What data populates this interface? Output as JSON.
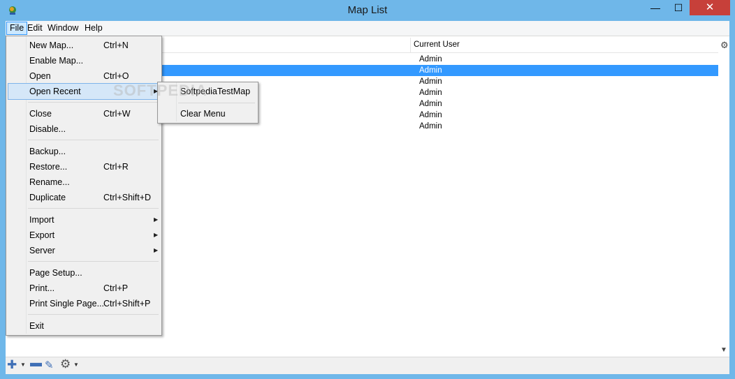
{
  "window": {
    "title": "Map List",
    "minimize_glyph": "—",
    "maximize_glyph": "☐",
    "close_glyph": "✕"
  },
  "menubar": {
    "file": "File",
    "edit": "Edit",
    "window": "Window",
    "help": "Help"
  },
  "table": {
    "column_header": "Current User",
    "rows": [
      "Admin",
      "Admin",
      "Admin",
      "Admin",
      "Admin",
      "Admin",
      "Admin"
    ],
    "selected_row": 1
  },
  "file_menu": {
    "items": [
      {
        "label": "New Map...",
        "shortcut": "Ctrl+N"
      },
      {
        "label": "Enable Map...",
        "shortcut": ""
      },
      {
        "label": "Open",
        "shortcut": "Ctrl+O"
      },
      {
        "label": "Open Recent",
        "shortcut": ""
      },
      {
        "label": "Close",
        "shortcut": "Ctrl+W"
      },
      {
        "label": "Disable...",
        "shortcut": ""
      },
      {
        "label": "Backup...",
        "shortcut": ""
      },
      {
        "label": "Restore...",
        "shortcut": "Ctrl+R"
      },
      {
        "label": "Rename...",
        "shortcut": ""
      },
      {
        "label": "Duplicate",
        "shortcut": "Ctrl+Shift+D"
      },
      {
        "label": "Import",
        "shortcut": ""
      },
      {
        "label": "Export",
        "shortcut": ""
      },
      {
        "label": "Server",
        "shortcut": ""
      },
      {
        "label": "Page Setup...",
        "shortcut": ""
      },
      {
        "label": "Print...",
        "shortcut": "Ctrl+P"
      },
      {
        "label": "Print Single Page...",
        "shortcut": "Ctrl+Shift+P"
      },
      {
        "label": "Exit",
        "shortcut": ""
      }
    ]
  },
  "open_recent_submenu": {
    "items": [
      "SoftpediaTestMap",
      "Clear Menu"
    ]
  },
  "watermark": "SOFTPEDIA",
  "icons": {
    "submenu_arrow": "▶",
    "dropdown_arrow": "▼",
    "add": "✚",
    "remove": "▬",
    "edit": "✎",
    "gear": "⚙",
    "scroll_down": "▼"
  },
  "colors": {
    "titlebar": "#6fb7e9",
    "selection": "#3399ff",
    "close_button": "#c7403a"
  }
}
